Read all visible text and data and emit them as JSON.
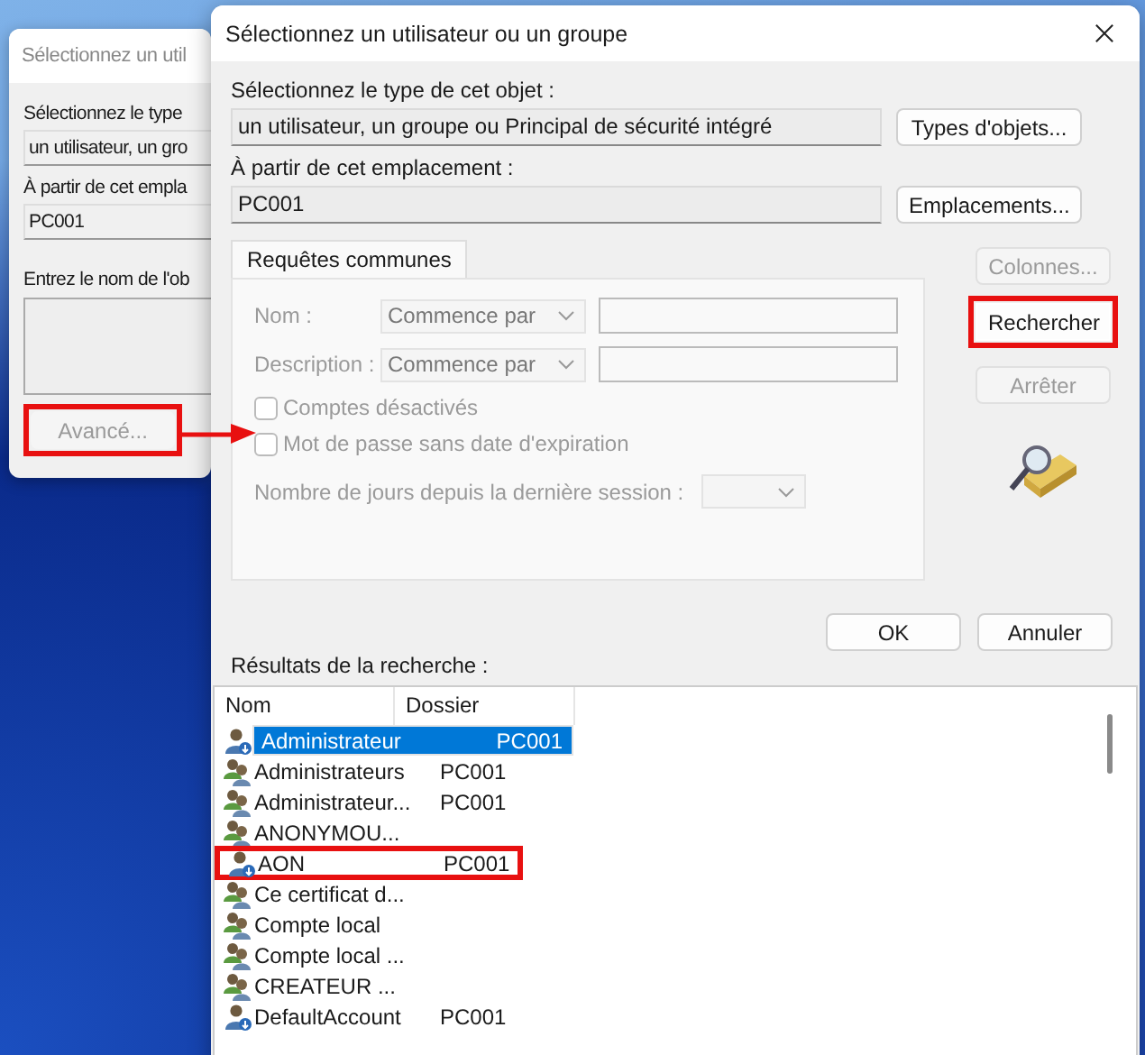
{
  "back_window": {
    "title": "Sélectionnez un util",
    "type_label": "Sélectionnez le type",
    "type_value": "un utilisateur, un gro",
    "location_label": "À partir de cet empla",
    "location_value": "PC001",
    "name_label": "Entrez le nom de l'ob",
    "advanced_button": {
      "label": "Avancé...",
      "disabled": true,
      "highlighted": true
    }
  },
  "window": {
    "title": "Sélectionnez un utilisateur ou un groupe"
  },
  "object_type": {
    "label": "Sélectionnez le type de cet objet :",
    "value": "un utilisateur, un groupe ou Principal de sécurité intégré",
    "button": "Types d'objets..."
  },
  "location": {
    "label": "À partir de cet emplacement :",
    "value": "PC001",
    "button": "Emplacements..."
  },
  "tabs": [
    {
      "label": "Requêtes communes",
      "selected": true
    }
  ],
  "query": {
    "fields": [
      {
        "label": "Nom :",
        "operator": "Commence par",
        "disabled": true
      },
      {
        "label": "Description :",
        "operator": "Commence par",
        "disabled": true
      }
    ],
    "checkboxes": [
      {
        "label": "Comptes désactivés",
        "checked": false,
        "disabled": true
      },
      {
        "label": "Mot de passe sans date d'expiration",
        "checked": false,
        "disabled": true
      }
    ],
    "days_label": "Nombre de jours depuis la dernière session :"
  },
  "side_buttons": [
    {
      "label": "Colonnes...",
      "disabled": true,
      "highlighted": false
    },
    {
      "label": "Rechercher",
      "disabled": false,
      "highlighted": true
    },
    {
      "label": "Arrêter",
      "disabled": true,
      "highlighted": false
    }
  ],
  "dialog_buttons": [
    "OK",
    "Annuler"
  ],
  "results": {
    "label": "Résultats de la recherche :",
    "columns": [
      "Nom",
      "Dossier"
    ],
    "rows": [
      {
        "kind": "user",
        "name": "Administrateur",
        "folder": "PC001",
        "selected": true,
        "highlighted": false
      },
      {
        "kind": "group",
        "name": "Administrateurs",
        "folder": "PC001",
        "selected": false,
        "highlighted": false
      },
      {
        "kind": "group",
        "name": "Administrateur...",
        "folder": "PC001",
        "selected": false,
        "highlighted": false
      },
      {
        "kind": "group",
        "name": "ANONYMOU...",
        "selected": false,
        "highlighted": false
      },
      {
        "kind": "user",
        "name": "AON",
        "folder": "PC001",
        "selected": false,
        "highlighted": true
      },
      {
        "kind": "group",
        "name": "Ce certificat d...",
        "selected": false,
        "highlighted": false
      },
      {
        "kind": "group",
        "name": "Compte local",
        "selected": false,
        "highlighted": false
      },
      {
        "kind": "group",
        "name": "Compte local ...",
        "selected": false,
        "highlighted": false
      },
      {
        "kind": "group",
        "name": "CREATEUR ...",
        "selected": false,
        "highlighted": false
      },
      {
        "kind": "user",
        "name": "DefaultAccount",
        "folder": "PC001",
        "selected": false,
        "highlighted": false
      }
    ]
  }
}
